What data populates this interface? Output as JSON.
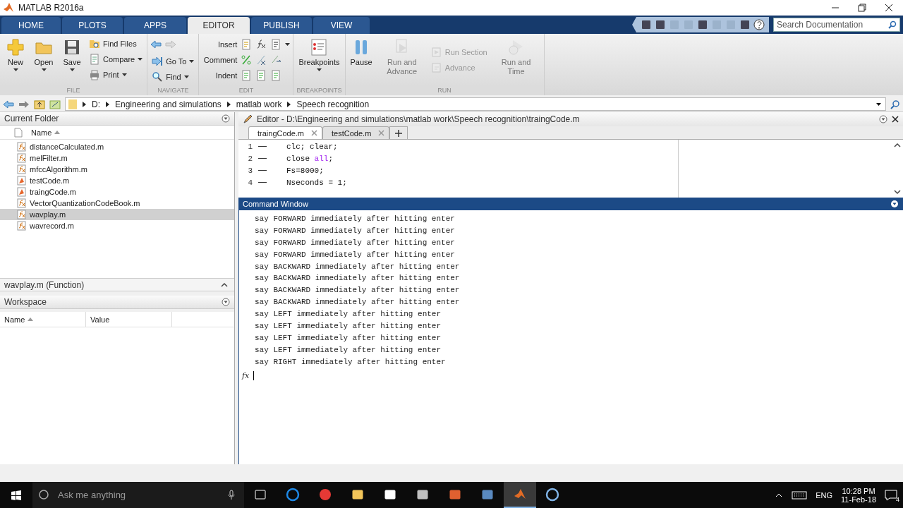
{
  "window": {
    "title": "MATLAB R2016a"
  },
  "tabs": [
    {
      "label": "HOME",
      "selected": false
    },
    {
      "label": "PLOTS",
      "selected": false
    },
    {
      "label": "APPS",
      "selected": false
    },
    {
      "label": "EDITOR",
      "selected": true
    },
    {
      "label": "PUBLISH",
      "selected": false
    },
    {
      "label": "VIEW",
      "selected": false
    }
  ],
  "search": {
    "placeholder": "Search Documentation"
  },
  "toolstrip": [
    {
      "label": "FILE",
      "items": [
        {
          "kind": "large",
          "label": "New",
          "menu": true,
          "disabled": false
        },
        {
          "kind": "large",
          "label": "Open",
          "menu": true,
          "disabled": false
        },
        {
          "kind": "large",
          "label": "Save",
          "menu": true,
          "disabled": false
        },
        {
          "kind": "stack",
          "items": [
            {
              "label": "Find Files",
              "menu": false,
              "disabled": false
            },
            {
              "label": "Compare",
              "menu": true,
              "disabled": false
            },
            {
              "label": "Print",
              "menu": true,
              "disabled": false
            }
          ]
        }
      ]
    },
    {
      "label": "NAVIGATE",
      "items": [
        {
          "kind": "stack",
          "items": [
            {
              "kind": "arrows"
            },
            {
              "label": "Go To",
              "menu": true,
              "disabled": false
            },
            {
              "label": "Find",
              "menu": true,
              "disabled": false
            }
          ]
        }
      ]
    },
    {
      "label": "EDIT",
      "items": [
        {
          "kind": "rows",
          "items": [
            {
              "label": "Insert",
              "menu": true,
              "disabled": false
            },
            {
              "label": "Comment",
              "menu": false,
              "disabled": false
            },
            {
              "label": "Indent",
              "menu": false,
              "disabled": false
            }
          ]
        }
      ]
    },
    {
      "label": "BREAKPOINTS",
      "items": [
        {
          "kind": "large",
          "label": "Breakpoints",
          "menu": true,
          "disabled": false
        }
      ]
    },
    {
      "label": "RUN",
      "items": [
        {
          "kind": "large",
          "label": "Pause",
          "menu": false,
          "disabled": false
        },
        {
          "kind": "large",
          "label": "Run and Advance",
          "menu": false,
          "disabled": true
        },
        {
          "kind": "stack",
          "items": [
            {
              "label": "Run Section",
              "menu": false,
              "disabled": true
            },
            {
              "label": "Advance",
              "menu": false,
              "disabled": true
            }
          ]
        },
        {
          "kind": "large",
          "label": "Run and Time",
          "menu": false,
          "disabled": true
        }
      ]
    }
  ],
  "address": [
    "D:",
    "Engineering and simulations",
    "matlab work",
    "Speech recognition"
  ],
  "current_folder": {
    "title": "Current Folder",
    "column": "Name",
    "files": [
      {
        "name": "distanceCalculated.m",
        "kind": "function",
        "selected": false
      },
      {
        "name": "melFilter.m",
        "kind": "function",
        "selected": false
      },
      {
        "name": "mfccAlgorithm.m",
        "kind": "function",
        "selected": false
      },
      {
        "name": "testCode.m",
        "kind": "script",
        "selected": false
      },
      {
        "name": "traingCode.m",
        "kind": "script",
        "selected": false
      },
      {
        "name": "VectorQuantizationCodeBook.m",
        "kind": "function",
        "selected": false
      },
      {
        "name": "wavplay.m",
        "kind": "function",
        "selected": true
      },
      {
        "name": "wavrecord.m",
        "kind": "function",
        "selected": false
      }
    ],
    "details": "wavplay.m  (Function)"
  },
  "workspace": {
    "title": "Workspace",
    "columns": [
      "Name",
      "Value"
    ]
  },
  "editor": {
    "title": "Editor - D:\\Engineering and simulations\\matlab work\\Speech recognition\\traingCode.m",
    "tabs": [
      {
        "label": "traingCode.m",
        "selected": true
      },
      {
        "label": "testCode.m",
        "selected": false
      }
    ],
    "lines": [
      {
        "number": "1",
        "code": [
          {
            "kind": "plain",
            "text": "clc; clear;"
          }
        ]
      },
      {
        "number": "2",
        "code": [
          {
            "kind": "plain",
            "text": "close "
          },
          {
            "kind": "keyword",
            "text": "all"
          },
          {
            "kind": "plain",
            "text": ";"
          }
        ]
      },
      {
        "number": "3",
        "code": [
          {
            "kind": "plain",
            "text": "Fs=8000;"
          }
        ]
      },
      {
        "number": "4",
        "code": [
          {
            "kind": "plain",
            "text": "Nseconds = 1;"
          }
        ]
      }
    ]
  },
  "command_window": {
    "title": "Command Window",
    "prompt": "fx",
    "lines": [
      "say FORWARD immediately after hitting enter",
      "say FORWARD immediately after hitting enter",
      "say FORWARD immediately after hitting enter",
      "say FORWARD immediately after hitting enter",
      "say BACKWARD immediately after hitting enter",
      "say BACKWARD immediately after hitting enter",
      "say BACKWARD immediately after hitting enter",
      "say BACKWARD immediately after hitting enter",
      "say LEFT immediately after hitting enter",
      "say LEFT immediately after hitting enter",
      "say LEFT immediately after hitting enter",
      "say LEFT immediately after hitting enter",
      "say RIGHT immediately after hitting enter"
    ]
  },
  "taskbar": {
    "search_placeholder": "Ask me anything",
    "apps": [
      {
        "selected": false
      },
      {
        "selected": false
      },
      {
        "selected": false
      },
      {
        "selected": false
      },
      {
        "selected": false
      },
      {
        "selected": false
      },
      {
        "selected": false
      },
      {
        "selected": false
      },
      {
        "selected": true
      },
      {
        "selected": false
      }
    ],
    "language": "ENG",
    "time": "10:28 PM",
    "date": "11-Feb-18",
    "notifications": "4"
  }
}
